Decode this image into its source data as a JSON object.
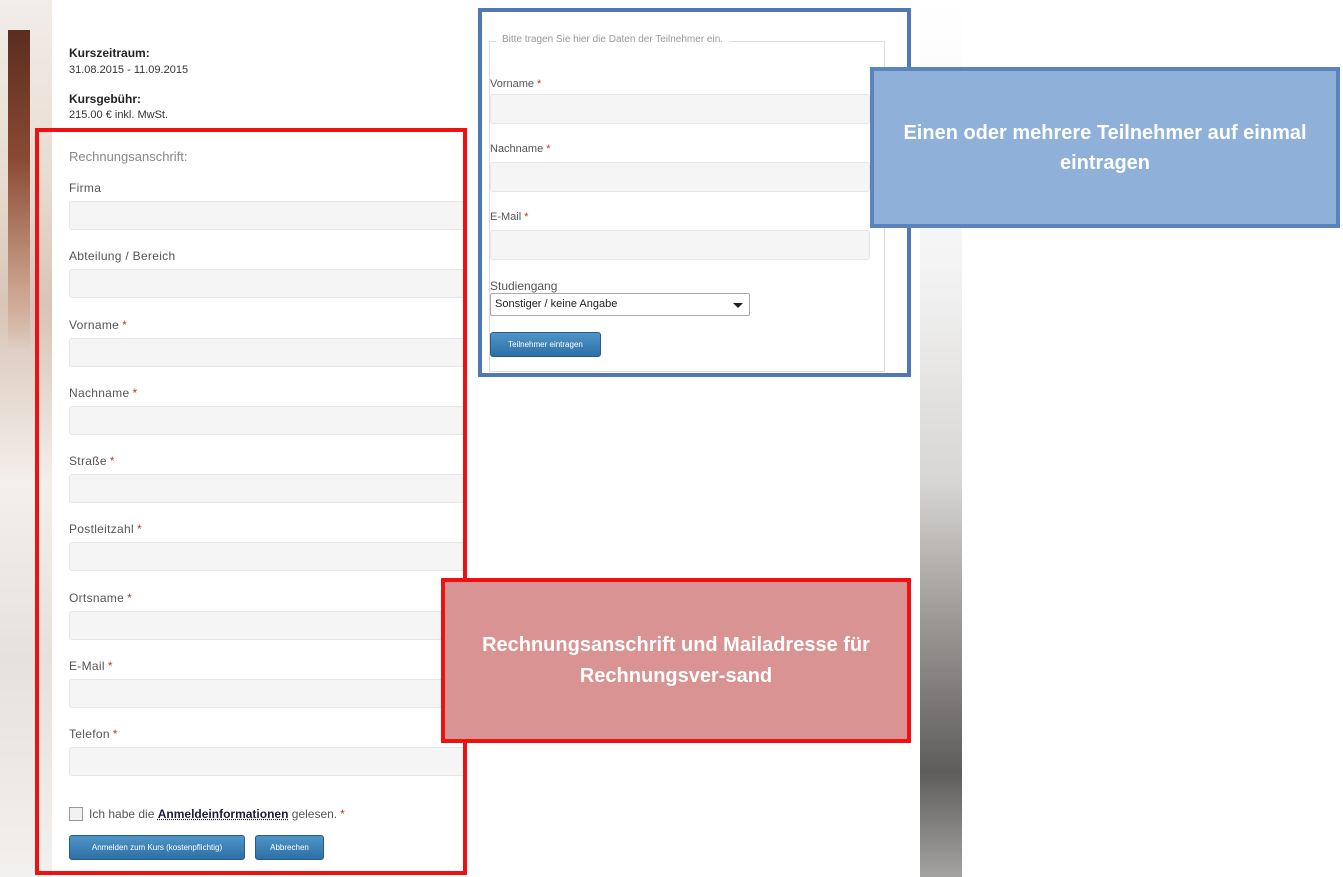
{
  "course": {
    "period_label": "Kurszeitraum:",
    "period_value": "31.08.2015 - 11.09.2015",
    "fee_label": "Kursgebühr:",
    "fee_value": "215.00 € inkl. MwSt."
  },
  "billing": {
    "title": "Rechnungsanschrift:",
    "fields": [
      {
        "label": "Firma",
        "required": false,
        "value": ""
      },
      {
        "label": "Abteilung / Bereich",
        "required": false,
        "value": ""
      },
      {
        "label": "Vorname",
        "required": true,
        "value": ""
      },
      {
        "label": "Nachname",
        "required": true,
        "value": ""
      },
      {
        "label": "Straße",
        "required": true,
        "value": ""
      },
      {
        "label": "Postleitzahl",
        "required": true,
        "value": ""
      },
      {
        "label": "Ortsname",
        "required": true,
        "value": ""
      },
      {
        "label": "E-Mail",
        "required": true,
        "value": ""
      },
      {
        "label": "Telefon",
        "required": true,
        "value": ""
      }
    ],
    "required_marker": "*",
    "checkbox_prefix": "Ich habe die",
    "checkbox_link": "Anmeldeinformationen",
    "checkbox_suffix": "gelesen.",
    "checkbox_checked": false,
    "submit_label": "Anmelden zum Kurs (kostenpflichtig)",
    "cancel_label": "Abbrechen"
  },
  "participants": {
    "legend": "Bitte tragen Sie hier die Daten der Teilnehmer ein.",
    "fields": [
      {
        "label": "Vorname",
        "required": true,
        "value": ""
      },
      {
        "label": "Nachname",
        "required": true,
        "value": ""
      },
      {
        "label": "E-Mail",
        "required": true,
        "value": ""
      }
    ],
    "program_label": "Studiengang",
    "program_selected": "Sonstiger / keine Angabe",
    "add_button_label": "Teilnehmer eintragen"
  },
  "callouts": {
    "blue_text": "Einen oder mehrere Teilnehmer auf einmal eintragen",
    "red_text": "Rechnungsanschrift und Mailadresse für Rechnungsver-sand"
  },
  "colors": {
    "required": "#c0392b",
    "button": "#3a80b8",
    "red_frame": "#ee1111",
    "blue_frame": "#4f79b5",
    "blue_callout": "#8eb0d9",
    "red_callout": "#d99393"
  }
}
